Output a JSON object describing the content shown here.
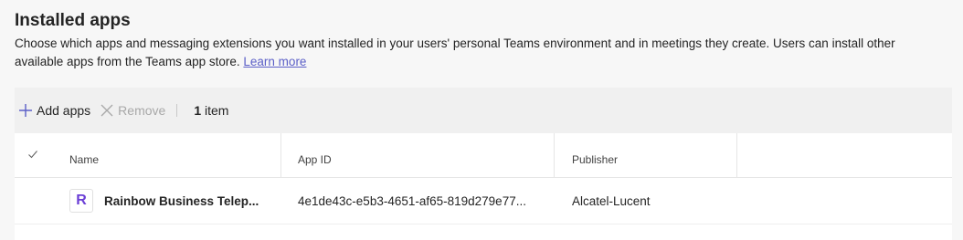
{
  "header": {
    "title": "Installed apps",
    "description": "Choose which apps and messaging extensions you want installed in your users' personal Teams environment and in meetings they create. Users can install other available apps from the Teams app store.",
    "learn_more": "Learn more"
  },
  "toolbar": {
    "add_label": "Add apps",
    "remove_label": "Remove",
    "count_number": "1",
    "count_suffix": "item"
  },
  "table": {
    "columns": [
      "Name",
      "App ID",
      "Publisher"
    ],
    "rows": [
      {
        "logo_letter": "R",
        "name": "Rainbow Business Telep...",
        "app_id": "4e1de43c-e5b3-4651-af65-819d279e77...",
        "publisher": "Alcatel-Lucent"
      }
    ]
  },
  "colors": {
    "accent": "#5b5fc7",
    "app_logo": "#6b3fd6"
  }
}
